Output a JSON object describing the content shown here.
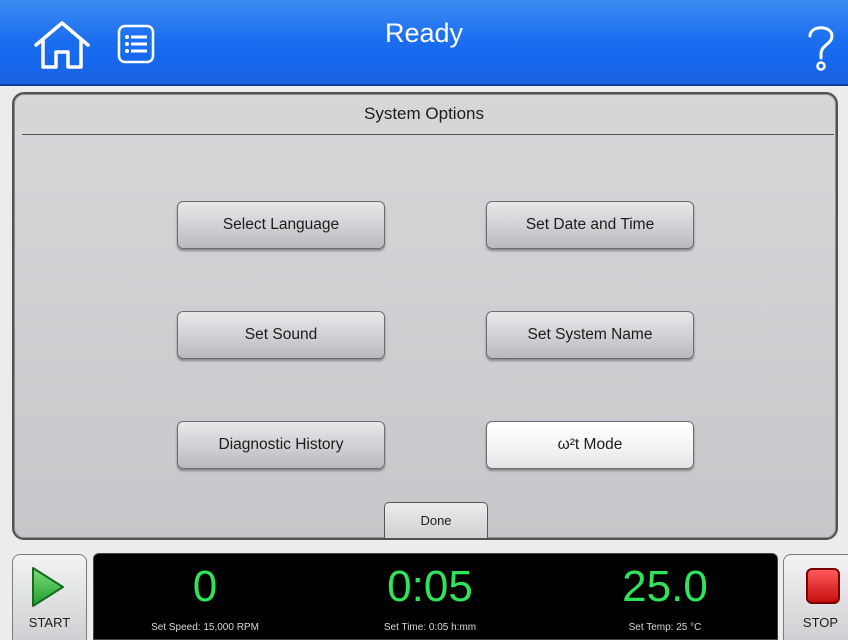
{
  "header": {
    "title": "Ready",
    "home_icon": "home-icon",
    "menu_icon": "list-menu-icon",
    "help_icon": "question-mark-icon",
    "accent_color": "#1d6ff0"
  },
  "panel": {
    "title": "System Options",
    "buttons": [
      {
        "label": "Select Language"
      },
      {
        "label": "Set Date and Time"
      },
      {
        "label": "Set Sound"
      },
      {
        "label": "Set System Name"
      },
      {
        "label": "Diagnostic History"
      },
      {
        "label": "ω²t Mode"
      }
    ],
    "done_label": "Done"
  },
  "footer": {
    "start_label": "START",
    "stop_label": "STOP",
    "speed": {
      "value": "0",
      "setpoint": "Set Speed: 15,000 RPM"
    },
    "time": {
      "value": "0:05",
      "setpoint": "Set Time: 0:05 h:mm"
    },
    "temp": {
      "value": "25.0",
      "setpoint": "Set Temp: 25 °C"
    },
    "readout_color": "#2fe35a"
  }
}
